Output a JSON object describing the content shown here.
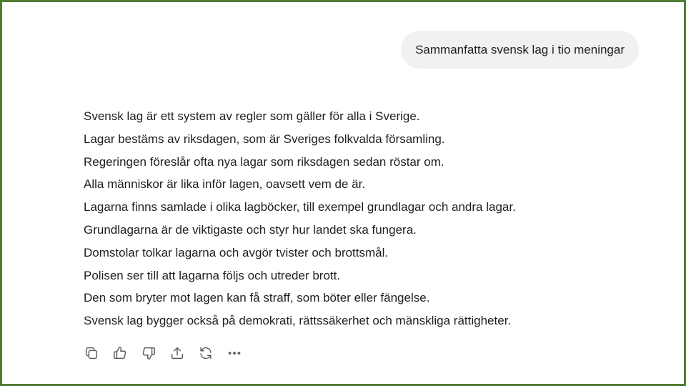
{
  "user_message": {
    "text": "Sammanfatta svensk lag i tio meningar"
  },
  "assistant_message": {
    "sentences": [
      "Svensk lag är ett system av regler som gäller för alla i Sverige.",
      "Lagar bestäms av riksdagen, som är Sveriges folkvalda församling.",
      "Regeringen föreslår ofta nya lagar som riksdagen sedan röstar om.",
      "Alla människor är lika inför lagen, oavsett vem de är.",
      "Lagarna finns samlade i olika lagböcker, till exempel grundlagar och andra lagar.",
      "Grundlagarna är de viktigaste och styr hur landet ska fungera.",
      "Domstolar tolkar lagarna och avgör tvister och brottsmål.",
      "Polisen ser till att lagarna följs och utreder brott.",
      "Den som bryter mot lagen kan få straff, som böter eller fängelse.",
      "Svensk lag bygger också på demokrati, rättssäkerhet och mänskliga rättigheter."
    ]
  },
  "actions": [
    {
      "icon": "copy-icon"
    },
    {
      "icon": "thumbs-up-icon"
    },
    {
      "icon": "thumbs-down-icon"
    },
    {
      "icon": "share-icon"
    },
    {
      "icon": "regenerate-icon"
    },
    {
      "icon": "more-icon"
    }
  ],
  "colors": {
    "frame_border": "#4e7d32",
    "bubble_bg": "#f1f1f1",
    "text": "#1f1f1f",
    "icon": "#5d5d5d"
  }
}
